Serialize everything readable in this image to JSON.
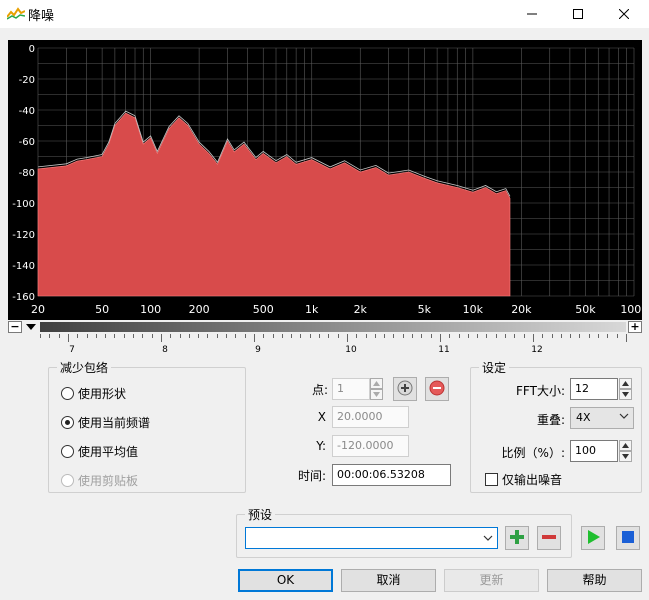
{
  "window": {
    "title": "降噪"
  },
  "spectrum": {
    "y_axis_labels": [
      "0",
      "-20",
      "-40",
      "-60",
      "-80",
      "-100",
      "-120",
      "-140",
      "-160"
    ],
    "x_axis_labels": [
      "20",
      "50",
      "100",
      "200",
      "500",
      "1k",
      "2k",
      "5k",
      "10k",
      "20k",
      "50k",
      "100k"
    ]
  },
  "scroll": {
    "minus_label": "−",
    "plus_label": "+",
    "ruler_labels": [
      "7",
      "8",
      "9",
      "10",
      "11",
      "12"
    ]
  },
  "envelope": {
    "group_title": "减少包络",
    "options": [
      {
        "label": "使用形状",
        "checked": false,
        "enabled": true
      },
      {
        "label": "使用当前频谱",
        "checked": true,
        "enabled": true
      },
      {
        "label": "使用平均值",
        "checked": false,
        "enabled": true
      },
      {
        "label": "使用剪贴板",
        "checked": false,
        "enabled": false
      }
    ]
  },
  "point": {
    "point_label": "点:",
    "point_value": "1",
    "x_label": "X",
    "x_value": "20.0000",
    "y_label": "Y:",
    "y_value": "-120.0000",
    "time_label": "时间:",
    "time_value": "00:00:06.53208"
  },
  "settings": {
    "group_title": "设定",
    "fft_label": "FFT大小:",
    "fft_value": "12",
    "overlap_label": "重叠:",
    "overlap_value": "4X",
    "ratio_label": "比例（%）:",
    "ratio_value": "100",
    "noise_only_label": "仅输出噪音"
  },
  "preset": {
    "group_title": "预设",
    "value": ""
  },
  "buttons": {
    "ok": "OK",
    "cancel": "取消",
    "update": "更新",
    "help": "帮助"
  },
  "colors": {
    "spectrum_fill": "#d84b4b",
    "spectrum_bg": "#000000",
    "add_green": "#2ea043",
    "remove_red": "#d03a3a",
    "play_green": "#1fbf2f",
    "stop_blue": "#1a5fd6",
    "accent": "#0078d7"
  }
}
